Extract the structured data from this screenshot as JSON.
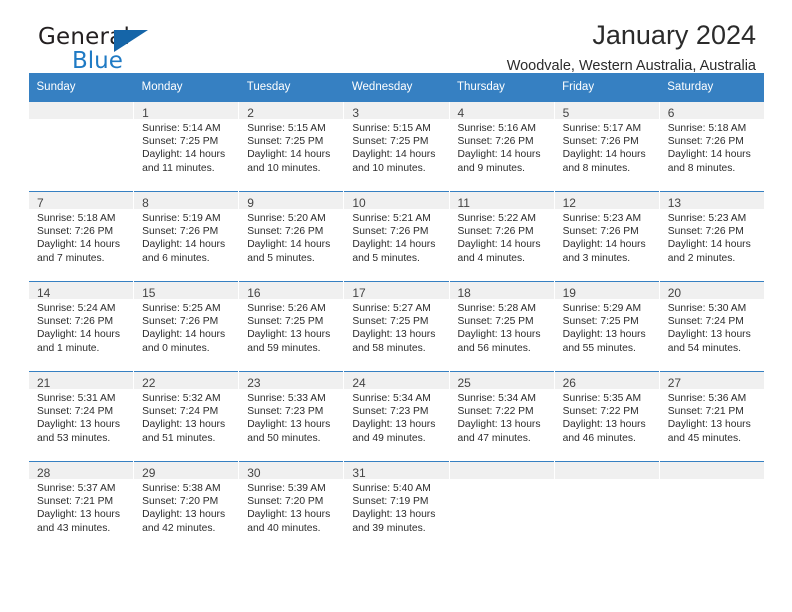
{
  "brand": {
    "name_top": "General",
    "name_bottom": "Blue",
    "accent_color": "#1f7ac4",
    "triangle_color": "#1565a8"
  },
  "header": {
    "title": "January 2024",
    "subtitle": "Woodvale, Western Australia, Australia"
  },
  "calendar": {
    "header_color": "#3680c2",
    "day_band_color": "#f0f0f0",
    "weekday_headers": [
      "Sunday",
      "Monday",
      "Tuesday",
      "Wednesday",
      "Thursday",
      "Friday",
      "Saturday"
    ],
    "weeks": [
      [
        {
          "day": "",
          "lines": []
        },
        {
          "day": "1",
          "lines": [
            "Sunrise: 5:14 AM",
            "Sunset: 7:25 PM",
            "Daylight: 14 hours",
            "and 11 minutes."
          ]
        },
        {
          "day": "2",
          "lines": [
            "Sunrise: 5:15 AM",
            "Sunset: 7:25 PM",
            "Daylight: 14 hours",
            "and 10 minutes."
          ]
        },
        {
          "day": "3",
          "lines": [
            "Sunrise: 5:15 AM",
            "Sunset: 7:25 PM",
            "Daylight: 14 hours",
            "and 10 minutes."
          ]
        },
        {
          "day": "4",
          "lines": [
            "Sunrise: 5:16 AM",
            "Sunset: 7:26 PM",
            "Daylight: 14 hours",
            "and 9 minutes."
          ]
        },
        {
          "day": "5",
          "lines": [
            "Sunrise: 5:17 AM",
            "Sunset: 7:26 PM",
            "Daylight: 14 hours",
            "and 8 minutes."
          ]
        },
        {
          "day": "6",
          "lines": [
            "Sunrise: 5:18 AM",
            "Sunset: 7:26 PM",
            "Daylight: 14 hours",
            "and 8 minutes."
          ]
        }
      ],
      [
        {
          "day": "7",
          "lines": [
            "Sunrise: 5:18 AM",
            "Sunset: 7:26 PM",
            "Daylight: 14 hours",
            "and 7 minutes."
          ]
        },
        {
          "day": "8",
          "lines": [
            "Sunrise: 5:19 AM",
            "Sunset: 7:26 PM",
            "Daylight: 14 hours",
            "and 6 minutes."
          ]
        },
        {
          "day": "9",
          "lines": [
            "Sunrise: 5:20 AM",
            "Sunset: 7:26 PM",
            "Daylight: 14 hours",
            "and 5 minutes."
          ]
        },
        {
          "day": "10",
          "lines": [
            "Sunrise: 5:21 AM",
            "Sunset: 7:26 PM",
            "Daylight: 14 hours",
            "and 5 minutes."
          ]
        },
        {
          "day": "11",
          "lines": [
            "Sunrise: 5:22 AM",
            "Sunset: 7:26 PM",
            "Daylight: 14 hours",
            "and 4 minutes."
          ]
        },
        {
          "day": "12",
          "lines": [
            "Sunrise: 5:23 AM",
            "Sunset: 7:26 PM",
            "Daylight: 14 hours",
            "and 3 minutes."
          ]
        },
        {
          "day": "13",
          "lines": [
            "Sunrise: 5:23 AM",
            "Sunset: 7:26 PM",
            "Daylight: 14 hours",
            "and 2 minutes."
          ]
        }
      ],
      [
        {
          "day": "14",
          "lines": [
            "Sunrise: 5:24 AM",
            "Sunset: 7:26 PM",
            "Daylight: 14 hours",
            "and 1 minute."
          ]
        },
        {
          "day": "15",
          "lines": [
            "Sunrise: 5:25 AM",
            "Sunset: 7:26 PM",
            "Daylight: 14 hours",
            "and 0 minutes."
          ]
        },
        {
          "day": "16",
          "lines": [
            "Sunrise: 5:26 AM",
            "Sunset: 7:25 PM",
            "Daylight: 13 hours",
            "and 59 minutes."
          ]
        },
        {
          "day": "17",
          "lines": [
            "Sunrise: 5:27 AM",
            "Sunset: 7:25 PM",
            "Daylight: 13 hours",
            "and 58 minutes."
          ]
        },
        {
          "day": "18",
          "lines": [
            "Sunrise: 5:28 AM",
            "Sunset: 7:25 PM",
            "Daylight: 13 hours",
            "and 56 minutes."
          ]
        },
        {
          "day": "19",
          "lines": [
            "Sunrise: 5:29 AM",
            "Sunset: 7:25 PM",
            "Daylight: 13 hours",
            "and 55 minutes."
          ]
        },
        {
          "day": "20",
          "lines": [
            "Sunrise: 5:30 AM",
            "Sunset: 7:24 PM",
            "Daylight: 13 hours",
            "and 54 minutes."
          ]
        }
      ],
      [
        {
          "day": "21",
          "lines": [
            "Sunrise: 5:31 AM",
            "Sunset: 7:24 PM",
            "Daylight: 13 hours",
            "and 53 minutes."
          ]
        },
        {
          "day": "22",
          "lines": [
            "Sunrise: 5:32 AM",
            "Sunset: 7:24 PM",
            "Daylight: 13 hours",
            "and 51 minutes."
          ]
        },
        {
          "day": "23",
          "lines": [
            "Sunrise: 5:33 AM",
            "Sunset: 7:23 PM",
            "Daylight: 13 hours",
            "and 50 minutes."
          ]
        },
        {
          "day": "24",
          "lines": [
            "Sunrise: 5:34 AM",
            "Sunset: 7:23 PM",
            "Daylight: 13 hours",
            "and 49 minutes."
          ]
        },
        {
          "day": "25",
          "lines": [
            "Sunrise: 5:34 AM",
            "Sunset: 7:22 PM",
            "Daylight: 13 hours",
            "and 47 minutes."
          ]
        },
        {
          "day": "26",
          "lines": [
            "Sunrise: 5:35 AM",
            "Sunset: 7:22 PM",
            "Daylight: 13 hours",
            "and 46 minutes."
          ]
        },
        {
          "day": "27",
          "lines": [
            "Sunrise: 5:36 AM",
            "Sunset: 7:21 PM",
            "Daylight: 13 hours",
            "and 45 minutes."
          ]
        }
      ],
      [
        {
          "day": "28",
          "lines": [
            "Sunrise: 5:37 AM",
            "Sunset: 7:21 PM",
            "Daylight: 13 hours",
            "and 43 minutes."
          ]
        },
        {
          "day": "29",
          "lines": [
            "Sunrise: 5:38 AM",
            "Sunset: 7:20 PM",
            "Daylight: 13 hours",
            "and 42 minutes."
          ]
        },
        {
          "day": "30",
          "lines": [
            "Sunrise: 5:39 AM",
            "Sunset: 7:20 PM",
            "Daylight: 13 hours",
            "and 40 minutes."
          ]
        },
        {
          "day": "31",
          "lines": [
            "Sunrise: 5:40 AM",
            "Sunset: 7:19 PM",
            "Daylight: 13 hours",
            "and 39 minutes."
          ]
        },
        {
          "day": "",
          "lines": []
        },
        {
          "day": "",
          "lines": []
        },
        {
          "day": "",
          "lines": []
        }
      ]
    ]
  }
}
